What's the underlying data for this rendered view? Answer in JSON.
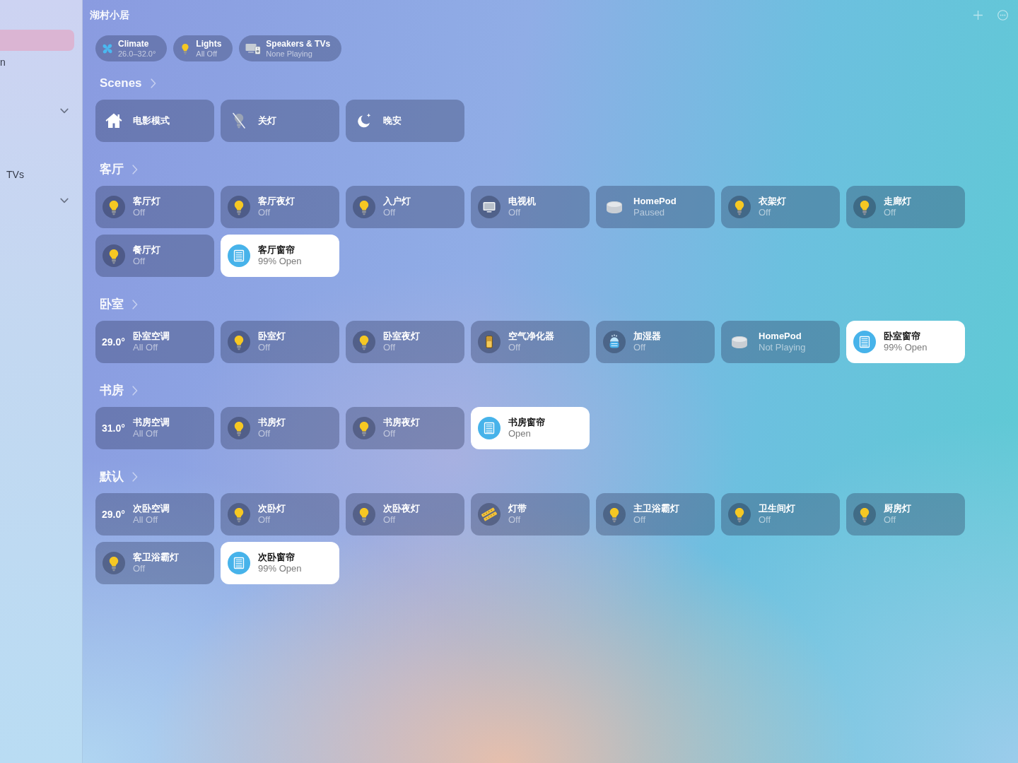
{
  "sidebar": {
    "items": [
      {
        "kind": "item",
        "selected": true
      },
      {
        "kind": "item",
        "label": "n",
        "selected": false
      },
      {
        "kind": "section",
        "expanded": true
      },
      {
        "kind": "item",
        "label": "TVs",
        "selected": false
      },
      {
        "kind": "section",
        "expanded": true
      }
    ]
  },
  "header": {
    "title": "湖村小居"
  },
  "summary": [
    {
      "kind": "climate",
      "title": "Climate",
      "subtitle": "26.0–32.0°"
    },
    {
      "kind": "lights",
      "title": "Lights",
      "subtitle": "All Off"
    },
    {
      "kind": "media",
      "title": "Speakers & TVs",
      "subtitle": "None Playing"
    }
  ],
  "scenes": {
    "title": "Scenes",
    "items": [
      {
        "kind": "home",
        "label": "电影模式"
      },
      {
        "kind": "lights-off",
        "label": "关灯"
      },
      {
        "kind": "night",
        "label": "晚安"
      }
    ]
  },
  "rooms": [
    {
      "title": "客厅",
      "accessories": [
        {
          "kind": "light",
          "name": "客厅灯",
          "status": "Off",
          "on": false
        },
        {
          "kind": "light",
          "name": "客厅夜灯",
          "status": "Off",
          "on": false
        },
        {
          "kind": "light",
          "name": "入户灯",
          "status": "Off",
          "on": false
        },
        {
          "kind": "tv",
          "name": "电视机",
          "status": "Off",
          "on": false
        },
        {
          "kind": "homepod",
          "name": "HomePod",
          "status": "Paused",
          "on": false
        },
        {
          "kind": "light",
          "name": "衣架灯",
          "status": "Off",
          "on": false
        },
        {
          "kind": "light",
          "name": "走廊灯",
          "status": "Off",
          "on": false
        },
        {
          "kind": "light",
          "name": "餐厅灯",
          "status": "Off",
          "on": false
        },
        {
          "kind": "blinds",
          "name": "客厅窗帘",
          "status": "99% Open",
          "on": true
        }
      ]
    },
    {
      "title": "卧室",
      "accessories": [
        {
          "kind": "climate",
          "reading": "29.0°",
          "name": "卧室空调",
          "status": "All Off",
          "on": false
        },
        {
          "kind": "light",
          "name": "卧室灯",
          "status": "Off",
          "on": false
        },
        {
          "kind": "light",
          "name": "卧室夜灯",
          "status": "Off",
          "on": false
        },
        {
          "kind": "purifier",
          "name": "空气净化器",
          "status": "Off",
          "on": false
        },
        {
          "kind": "humidifier",
          "name": "加湿器",
          "status": "Off",
          "on": false
        },
        {
          "kind": "homepod",
          "name": "HomePod",
          "status": "Not Playing",
          "on": false
        },
        {
          "kind": "blinds",
          "name": "卧室窗帘",
          "status": "99% Open",
          "on": true
        }
      ]
    },
    {
      "title": "书房",
      "accessories": [
        {
          "kind": "climate",
          "reading": "31.0°",
          "name": "书房空调",
          "status": "All Off",
          "on": false
        },
        {
          "kind": "light",
          "name": "书房灯",
          "status": "Off",
          "on": false
        },
        {
          "kind": "light",
          "name": "书房夜灯",
          "status": "Off",
          "on": false
        },
        {
          "kind": "blinds",
          "name": "书房窗帘",
          "status": "Open",
          "on": true
        }
      ]
    },
    {
      "title": "默认",
      "accessories": [
        {
          "kind": "climate",
          "reading": "29.0°",
          "name": "次卧空调",
          "status": "All Off",
          "on": false
        },
        {
          "kind": "light",
          "name": "次卧灯",
          "status": "Off",
          "on": false
        },
        {
          "kind": "light",
          "name": "次卧夜灯",
          "status": "Off",
          "on": false
        },
        {
          "kind": "strip",
          "name": "灯带",
          "status": "Off",
          "on": false
        },
        {
          "kind": "light",
          "name": "主卫浴霸灯",
          "status": "Off",
          "on": false
        },
        {
          "kind": "light",
          "name": "卫生间灯",
          "status": "Off",
          "on": false
        },
        {
          "kind": "light",
          "name": "厨房灯",
          "status": "Off",
          "on": false
        },
        {
          "kind": "light",
          "name": "客卫浴霸灯",
          "status": "Off",
          "on": false
        },
        {
          "kind": "blinds",
          "name": "次卧窗帘",
          "status": "99% Open",
          "on": true
        }
      ]
    }
  ]
}
